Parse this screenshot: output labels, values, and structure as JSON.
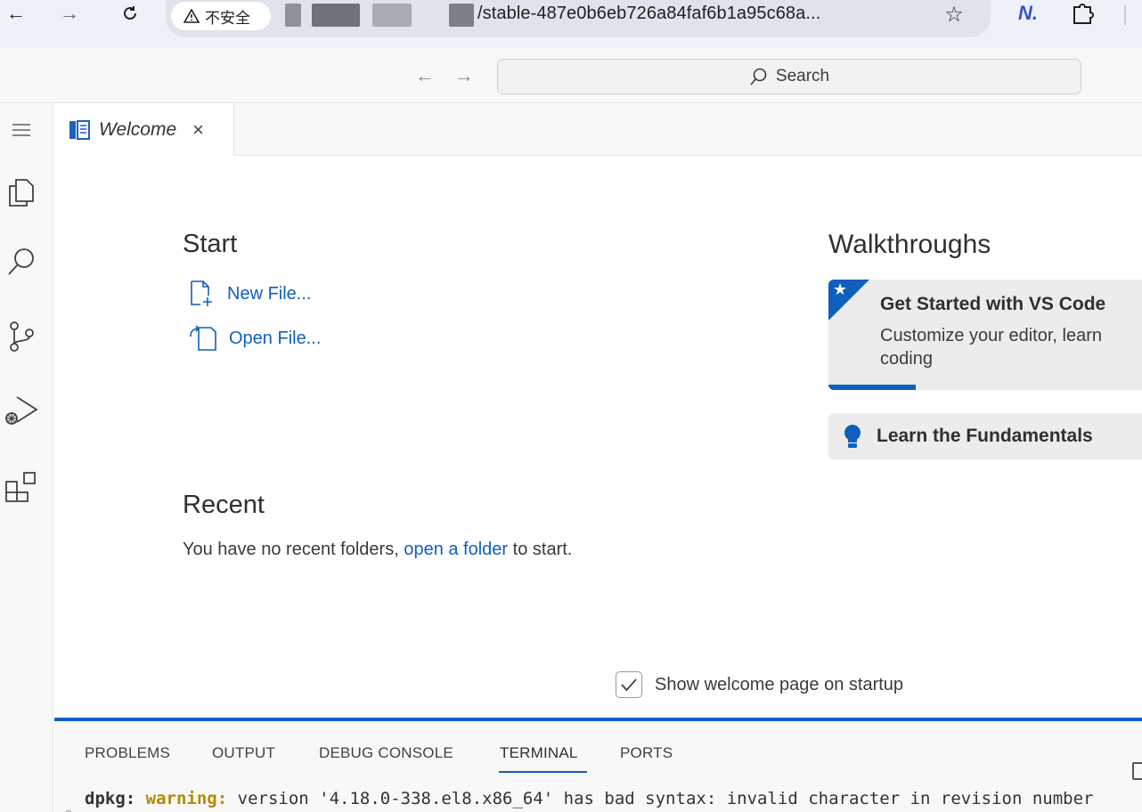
{
  "browser": {
    "security_label": "不安全",
    "url_visible": "/stable-487e0b6eb726a84faf6b1a95c68a...",
    "extension_letter": "N."
  },
  "vscode": {
    "title_bar": {
      "search_label": "Search"
    },
    "tab": {
      "label": "Welcome",
      "close_glyph": "×"
    },
    "welcome": {
      "start_heading": "Start",
      "start_links": [
        {
          "label": "New File...",
          "icon": "new-file-icon"
        },
        {
          "label": "Open File...",
          "icon": "open-file-icon"
        }
      ],
      "recent_heading": "Recent",
      "recent_text_before": "You have no recent folders,",
      "recent_link": "open a folder",
      "recent_text_after": "to start.",
      "walkthroughs_heading": "Walkthroughs",
      "walkthrough_card": {
        "title": "Get Started with VS Code",
        "description": "Customize your editor, learn coding"
      },
      "fundamentals_label": "Learn the Fundamentals",
      "startup_checkbox_label": "Show welcome page on startup",
      "startup_checked": true
    },
    "panel": {
      "tabs": [
        "PROBLEMS",
        "OUTPUT",
        "DEBUG CONSOLE",
        "TERMINAL",
        "PORTS"
      ],
      "active_tab": "TERMINAL",
      "terminal_prefix": "dpkg:",
      "terminal_warning": "warning:",
      "terminal_rest": "version '4.18.0-338.el8.x86_64' has bad syntax: invalid character in revision number"
    },
    "colors": {
      "accent": "#0f5fbf",
      "warning": "#b58900"
    }
  }
}
